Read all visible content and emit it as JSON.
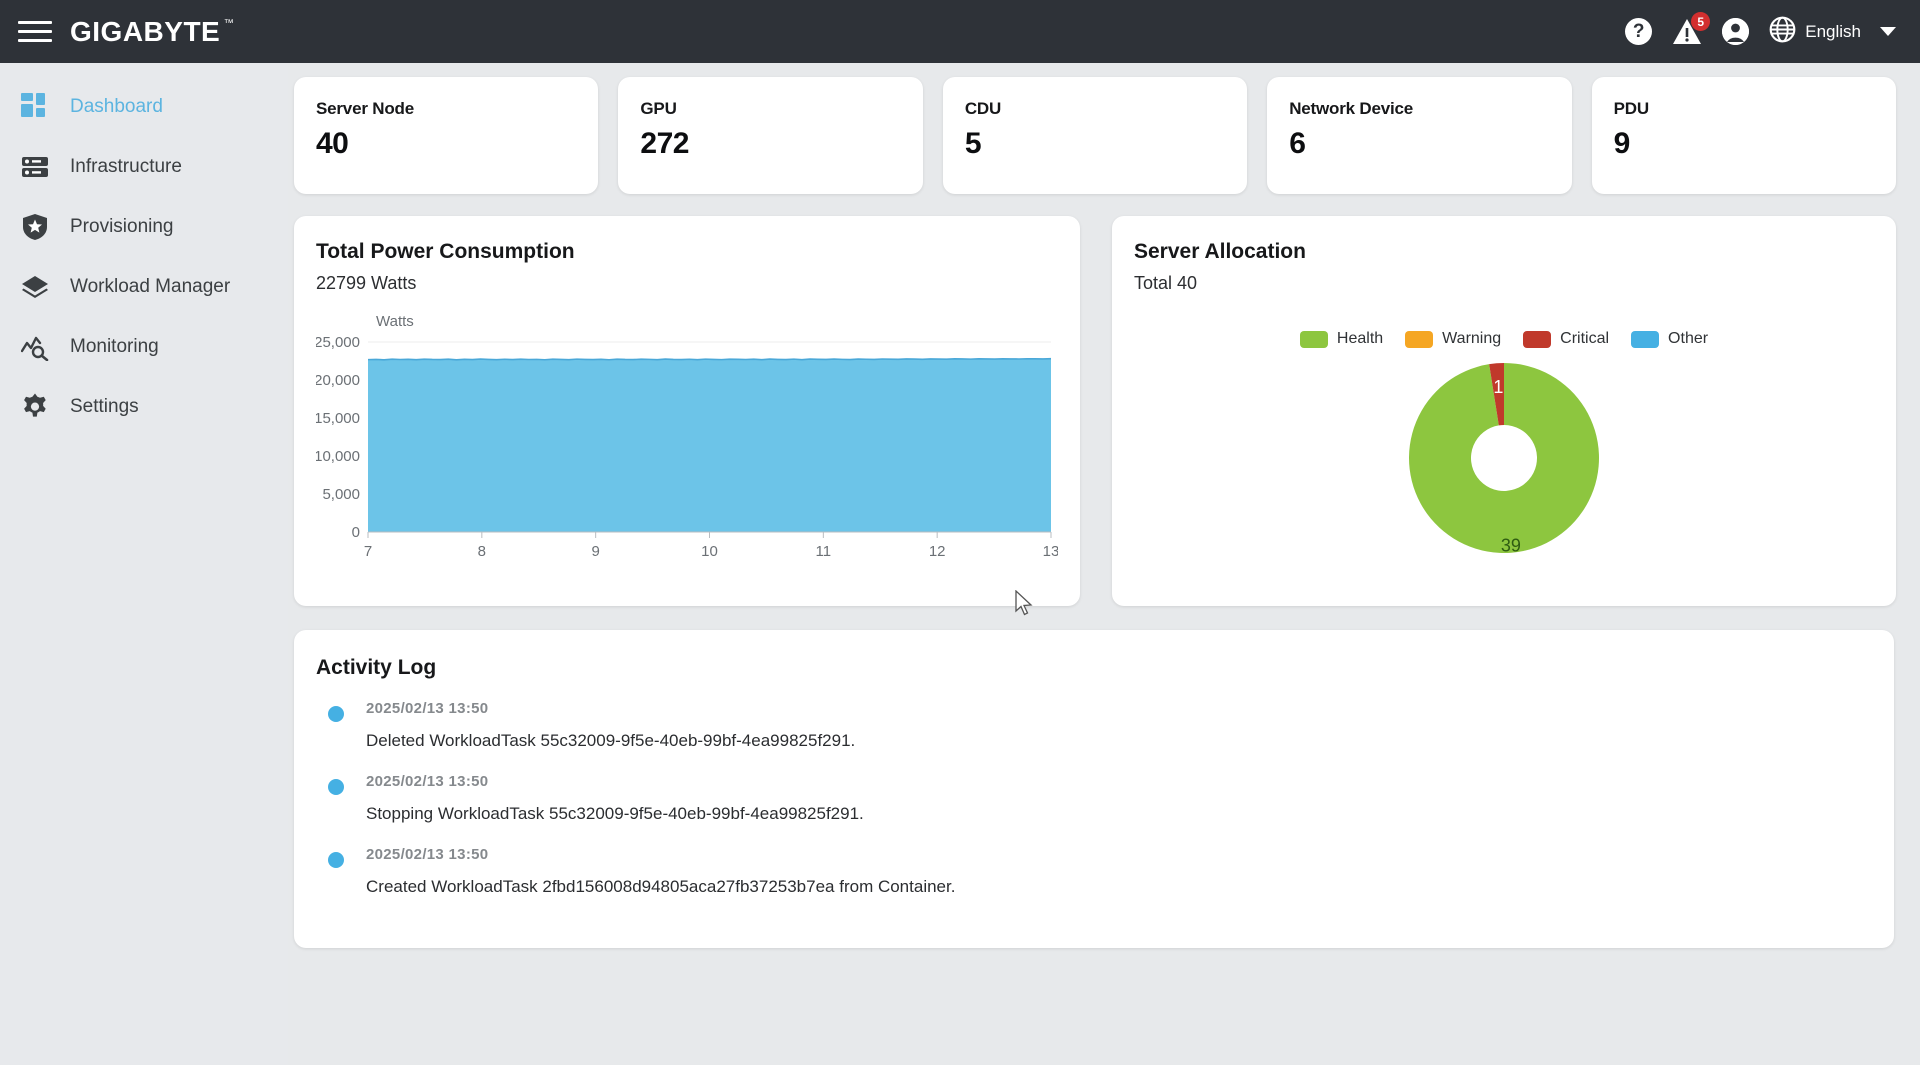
{
  "header": {
    "menu_icon": "hamburger-icon",
    "brand": "GIGABYTE",
    "brand_tm": "™",
    "help_icon": "question-mark-icon",
    "alert_icon": "warning-triangle-icon",
    "alert_count": "5",
    "account_icon": "user-account-icon",
    "globe_icon": "globe-icon",
    "language": "English",
    "dropdown_icon": "chevron-down-icon"
  },
  "sidebar": {
    "items": [
      {
        "label": "Dashboard",
        "icon": "dashboard-grid-icon",
        "active": true
      },
      {
        "label": "Infrastructure",
        "icon": "server-rack-icon",
        "active": false
      },
      {
        "label": "Provisioning",
        "icon": "shield-star-icon",
        "active": false
      },
      {
        "label": "Workload Manager",
        "icon": "layers-icon",
        "active": false
      },
      {
        "label": "Monitoring",
        "icon": "chart-magnifier-icon",
        "active": false
      },
      {
        "label": "Settings",
        "icon": "gear-icon",
        "active": false
      }
    ]
  },
  "stats": [
    {
      "title": "Server Node",
      "value": "40"
    },
    {
      "title": "GPU",
      "value": "272"
    },
    {
      "title": "CDU",
      "value": "5"
    },
    {
      "title": "Network Device",
      "value": "6"
    },
    {
      "title": "PDU",
      "value": "9"
    }
  ],
  "power": {
    "title": "Total Power Consumption",
    "subtitle": "22799 Watts"
  },
  "allocation": {
    "title": "Server Allocation",
    "subtitle": "Total 40",
    "legend": [
      {
        "label": "Health",
        "color": "#8dc63f"
      },
      {
        "label": "Warning",
        "color": "#f5a623"
      },
      {
        "label": "Critical",
        "color": "#c0392b"
      },
      {
        "label": "Other",
        "color": "#45b0e3"
      }
    ],
    "slice_labels": {
      "critical": "1",
      "health": "39"
    }
  },
  "activity_log": {
    "title": "Activity Log",
    "entries": [
      {
        "time": "2025/02/13 13:50",
        "message": "Deleted WorkloadTask 55c32009-9f5e-40eb-99bf-4ea99825f291."
      },
      {
        "time": "2025/02/13 13:50",
        "message": "Stopping WorkloadTask 55c32009-9f5e-40eb-99bf-4ea99825f291."
      },
      {
        "time": "2025/02/13 13:50",
        "message": "Created WorkloadTask 2fbd156008d94805aca27fb37253b7ea from Container."
      }
    ]
  },
  "colors": {
    "header_bg": "#2e3238",
    "page_bg": "#e7e9eb",
    "accent_blue": "#5cb4e0",
    "area_fill": "#6cc4e8",
    "area_stroke": "#4aa8d8",
    "badge_red": "#d32f2f"
  },
  "chart_data": {
    "type": "area",
    "title": "Total Power Consumption",
    "subtitle": "22799 Watts",
    "xlabel": "",
    "ylabel": "Watts",
    "ylim": [
      0,
      25000
    ],
    "yticks": [
      "0",
      "5,000",
      "10,000",
      "15,000",
      "20,000",
      "25,000"
    ],
    "ytick_values": [
      0,
      5000,
      10000,
      15000,
      20000,
      25000
    ],
    "xticks": [
      "7",
      "8",
      "9",
      "10",
      "11",
      "12",
      "13"
    ],
    "xtick_values": [
      7,
      8,
      9,
      10,
      11,
      12,
      13
    ],
    "grid": true,
    "legend": "none",
    "series": [
      {
        "name": "Watts",
        "values": [
          22680,
          22712,
          22655,
          22740,
          22698,
          22725,
          22670,
          22745,
          22702,
          22688,
          22733,
          22660,
          22718,
          22695,
          22750,
          22707,
          22672,
          22729,
          22684,
          22741,
          22699,
          22713,
          22666,
          22736,
          22704,
          22679,
          22748,
          22710,
          22691,
          22727,
          22663,
          22744,
          22701,
          22686,
          22738,
          22715,
          22674,
          22752,
          22708,
          22693,
          22730,
          22668,
          22746,
          22705,
          22681,
          22742,
          22719,
          22697,
          22735,
          22671,
          22754,
          22711,
          22689,
          22747,
          22676,
          22756,
          22722,
          22700,
          22758,
          22714,
          22694,
          22761,
          22731,
          22709,
          22765,
          22743,
          22717,
          22770,
          22752,
          22726,
          22775,
          22760,
          22739,
          22781,
          22766,
          22748,
          22786,
          22772,
          22755,
          22790,
          22778,
          22762,
          22795,
          22783,
          22768,
          22799
        ]
      }
    ]
  },
  "donut_chart": {
    "type": "pie",
    "title": "Server Allocation",
    "subtitle": "Total 40",
    "total": 40,
    "categories": [
      "Health",
      "Warning",
      "Critical",
      "Other"
    ],
    "values": [
      39,
      0,
      1,
      0
    ],
    "colors": [
      "#8dc63f",
      "#f5a623",
      "#c0392b",
      "#45b0e3"
    ],
    "legend": "top",
    "donut_hole": 0.35
  }
}
